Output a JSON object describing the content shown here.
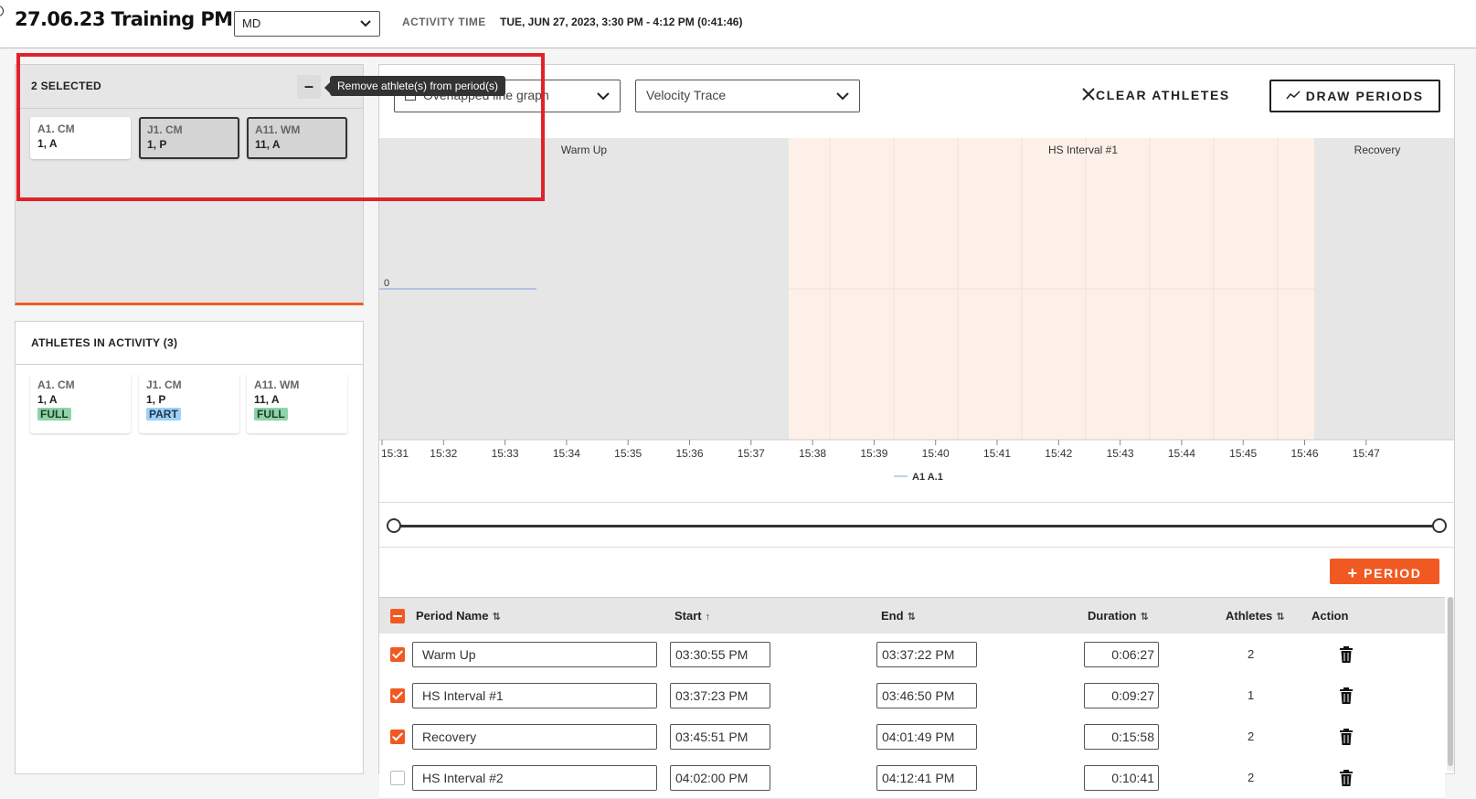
{
  "header": {
    "title": "27.06.23 Training PM",
    "session_select": "MD",
    "activity_label": "ACTIVITY TIME",
    "activity_value": "TUE, JUN 27, 2023, 3:30 PM - 4:12 PM (0:41:46)"
  },
  "selected_panel": {
    "count": "2 SELECTED",
    "remove_icon": "minus-icon",
    "tooltip": "Remove athlete(s) from period(s)",
    "chips": [
      {
        "name": "A1. CM",
        "sub": "1, A"
      },
      {
        "name": "J1. CM",
        "sub": "1, P"
      },
      {
        "name": "A11. WM",
        "sub": "11, A"
      }
    ]
  },
  "athletes_panel": {
    "title": "ATHLETES IN ACTIVITY (3)",
    "chips": [
      {
        "name": "A1. CM",
        "sub": "1, A",
        "tag": "FULL"
      },
      {
        "name": "J1. CM",
        "sub": "1, P",
        "tag": "PART"
      },
      {
        "name": "A11. WM",
        "sub": "11, A",
        "tag": "FULL"
      }
    ]
  },
  "toolbar": {
    "graph_type": "Overlapped line graph",
    "metric": "Velocity Trace",
    "clear_label": "CLEAR ATHLETES",
    "draw_label": "DRAW PERIODS",
    "add_period_label": "PERIOD"
  },
  "chart_data": {
    "type": "line",
    "x_ticks": [
      "15:31",
      "15:32",
      "15:33",
      "15:34",
      "15:35",
      "15:36",
      "15:37",
      "15:38",
      "15:39",
      "15:40",
      "15:41",
      "15:42",
      "15:43",
      "15:44",
      "15:45",
      "15:46",
      "15:47"
    ],
    "y_tick": "0",
    "period_bands": [
      {
        "label": "Warm Up",
        "start": "15:30:55",
        "end": "15:37:22"
      },
      {
        "label": "HS Interval #1",
        "start": "15:37:23",
        "end": "15:46:50"
      },
      {
        "label": "Recovery",
        "start": "15:45:51",
        "end": "16:01:49"
      }
    ],
    "series": [
      {
        "name": "A1 A.1",
        "color": "#7fa3d9"
      }
    ]
  },
  "table": {
    "headers": {
      "period_name": "Period Name",
      "start": "Start",
      "end": "End",
      "duration": "Duration",
      "athletes": "Athletes",
      "action": "Action"
    },
    "rows": [
      {
        "name": "Warm Up",
        "start": "03:30:55 PM",
        "end": "03:37:22 PM",
        "duration": "0:06:27",
        "athletes": "2",
        "checked": true
      },
      {
        "name": "HS Interval #1",
        "start": "03:37:23 PM",
        "end": "03:46:50 PM",
        "duration": "0:09:27",
        "athletes": "1",
        "checked": true
      },
      {
        "name": "Recovery",
        "start": "03:45:51 PM",
        "end": "04:01:49 PM",
        "duration": "0:15:58",
        "athletes": "2",
        "checked": true
      },
      {
        "name": "HS Interval #2",
        "start": "04:02:00 PM",
        "end": "04:12:41 PM",
        "duration": "0:10:41",
        "athletes": "2",
        "checked": false
      }
    ]
  },
  "colors": {
    "accent": "#f05a22",
    "band_grey": "#e6e6e6",
    "band_peach": "#fdf0e8",
    "highlight": "#e0222a"
  }
}
